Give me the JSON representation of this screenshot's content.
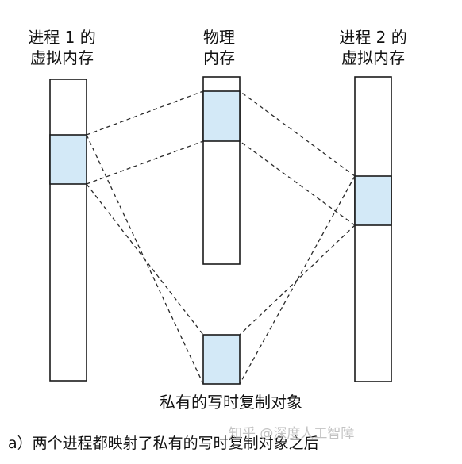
{
  "labels": {
    "process1": [
      "进程 1 的",
      "虚拟内存"
    ],
    "physical": [
      "物理",
      "内存"
    ],
    "process2": [
      "进程 2 的",
      "虚拟内存"
    ],
    "object_label": "私有的写时复制对象",
    "caption": "a）两个进程都映射了私有的写时复制对象之后"
  },
  "watermark": "知乎 @深度人工智障",
  "colors": {
    "region_fill": "#d3e9f7",
    "box_stroke": "#1a1a1a",
    "dash_stroke": "#2a2a2a"
  }
}
